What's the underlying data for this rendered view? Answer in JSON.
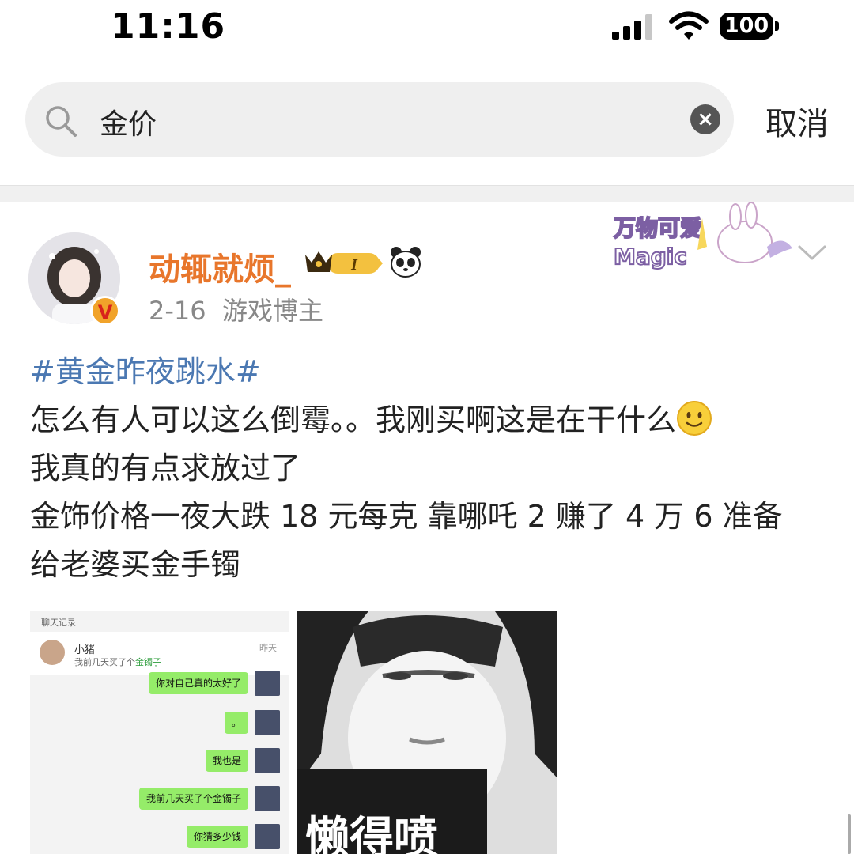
{
  "status_bar": {
    "time": "11:16",
    "battery": "100"
  },
  "search": {
    "query": "金价",
    "cancel_label": "取消"
  },
  "post": {
    "username": "动辄就烦_",
    "date": "2-16",
    "role": "游戏博主",
    "badge_level": "I",
    "hashtag": "#黄金昨夜跳水#",
    "line1": "怎么有人可以这么倒霉。。我刚买啊这是在干什么",
    "line2": "我真的有点求放过了",
    "line3": "金饰价格一夜大跌 18 元每克 靠哪吒 2 赚了 4 万 6 准备",
    "line4": "给老婆买金手镯",
    "verified_mark": "V",
    "sticker_text_1": "万物可爱",
    "sticker_text_2": "Magic"
  },
  "chat_image": {
    "title": "聊天记录",
    "contact_name": "小猪",
    "preview_prefix": "我前几天买了个",
    "preview_highlight": "金镯子",
    "date": "昨天",
    "messages": [
      "你对自己真的太好了",
      "。",
      "我也是",
      "我前几天买了个金镯子",
      "你猜多少钱"
    ]
  },
  "meme_image": {
    "caption": "懒得喷"
  },
  "colors": {
    "username": "#e8762b",
    "hashtag": "#4b78b2",
    "chat_bubble": "#95ec69"
  }
}
